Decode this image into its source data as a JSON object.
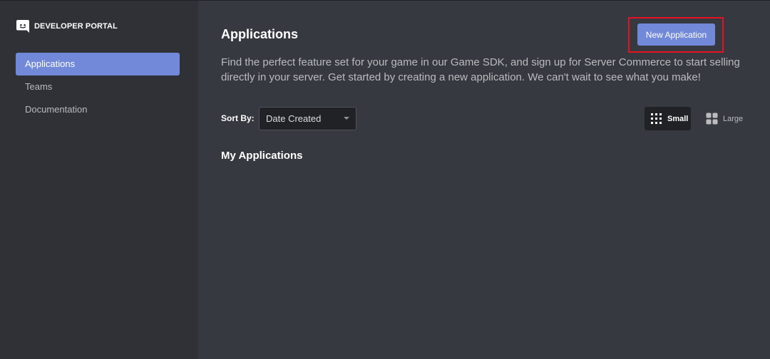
{
  "sidebar": {
    "brand": {
      "icon": "discord-logo-icon",
      "title": "DEVELOPER PORTAL"
    },
    "items": [
      {
        "label": "Applications",
        "active": true
      },
      {
        "label": "Teams",
        "active": false
      },
      {
        "label": "Documentation",
        "active": false
      }
    ]
  },
  "main": {
    "title": "Applications",
    "new_app_label": "New Application",
    "description": "Find the perfect feature set for your game in our Game SDK, and sign up for Server Commerce to start selling directly in your server. Get started by creating a new application. We can't wait to see what you make!",
    "sort": {
      "label": "Sort By:",
      "selected": "Date Created",
      "icon": "chevron-down-icon"
    },
    "view_toggle": {
      "small": {
        "label": "Small",
        "icon": "grid-small-icon",
        "active": true
      },
      "large": {
        "label": "Large",
        "icon": "grid-large-icon",
        "active": false
      }
    },
    "section_title": "My Applications"
  },
  "colors": {
    "accent": "#7289da",
    "highlight": "#e81123",
    "sidebar_bg": "#2f3136",
    "main_bg": "#36393f"
  }
}
